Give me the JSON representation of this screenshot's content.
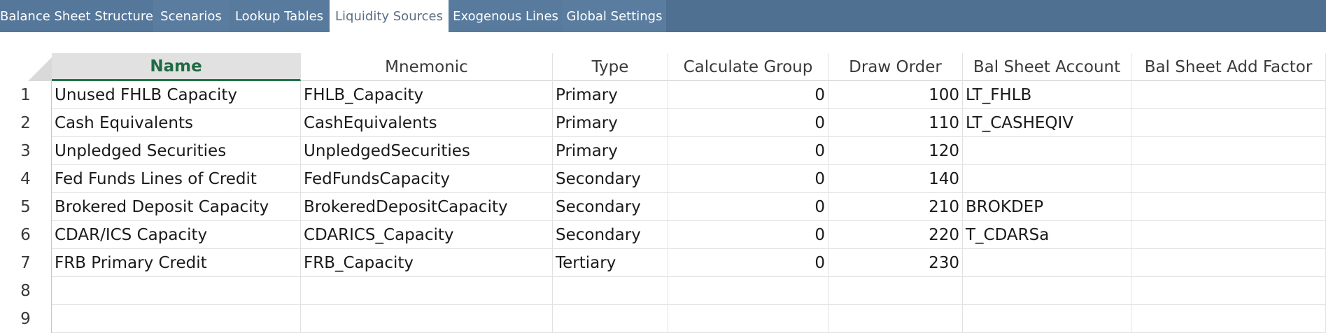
{
  "tabs": [
    {
      "label": "Balance Sheet Structure"
    },
    {
      "label": "Scenarios"
    },
    {
      "label": "Lookup Tables"
    },
    {
      "label": "Liquidity Sources"
    },
    {
      "label": "Exogenous Lines"
    },
    {
      "label": "Global Settings"
    }
  ],
  "active_tab": "Liquidity Sources",
  "columns": [
    {
      "label": "Name"
    },
    {
      "label": "Mnemonic"
    },
    {
      "label": "Type"
    },
    {
      "label": "Calculate Group"
    },
    {
      "label": "Draw Order"
    },
    {
      "label": "Bal Sheet Account"
    },
    {
      "label": "Bal Sheet Add Factor"
    }
  ],
  "rows": [
    {
      "num": "1",
      "name": "Unused FHLB Capacity",
      "mnemonic": "FHLB_Capacity",
      "type": "Primary",
      "calc_group": "0",
      "draw_order": "100",
      "bs_account": "LT_FHLB",
      "bs_add_factor": ""
    },
    {
      "num": "2",
      "name": "Cash Equivalents",
      "mnemonic": "CashEquivalents",
      "type": "Primary",
      "calc_group": "0",
      "draw_order": "110",
      "bs_account": "LT_CASHEQIV",
      "bs_add_factor": ""
    },
    {
      "num": "3",
      "name": "Unpledged Securities",
      "mnemonic": "UnpledgedSecurities",
      "type": "Primary",
      "calc_group": "0",
      "draw_order": "120",
      "bs_account": "",
      "bs_add_factor": ""
    },
    {
      "num": "4",
      "name": "Fed Funds Lines of Credit",
      "mnemonic": "FedFundsCapacity",
      "type": "Secondary",
      "calc_group": "0",
      "draw_order": "140",
      "bs_account": "",
      "bs_add_factor": ""
    },
    {
      "num": "5",
      "name": "Brokered Deposit Capacity",
      "mnemonic": "BrokeredDepositCapacity",
      "type": "Secondary",
      "calc_group": "0",
      "draw_order": "210",
      "bs_account": "BROKDEP",
      "bs_add_factor": ""
    },
    {
      "num": "6",
      "name": "CDAR/ICS Capacity",
      "mnemonic": "CDARICS_Capacity",
      "type": "Secondary",
      "calc_group": "0",
      "draw_order": "220",
      "bs_account": "T_CDARSa",
      "bs_add_factor": ""
    },
    {
      "num": "7",
      "name": "FRB Primary Credit",
      "mnemonic": "FRB_Capacity",
      "type": "Tertiary",
      "calc_group": "0",
      "draw_order": "230",
      "bs_account": "",
      "bs_add_factor": ""
    },
    {
      "num": "8",
      "name": "",
      "mnemonic": "",
      "type": "",
      "calc_group": "",
      "draw_order": "",
      "bs_account": "",
      "bs_add_factor": ""
    },
    {
      "num": "9",
      "name": "",
      "mnemonic": "",
      "type": "",
      "calc_group": "",
      "draw_order": "",
      "bs_account": "",
      "bs_add_factor": ""
    }
  ],
  "colors": {
    "tabbar_bg": "#4f7091",
    "selected_header_text": "#1f6b42",
    "selected_header_underline": "#217346"
  }
}
